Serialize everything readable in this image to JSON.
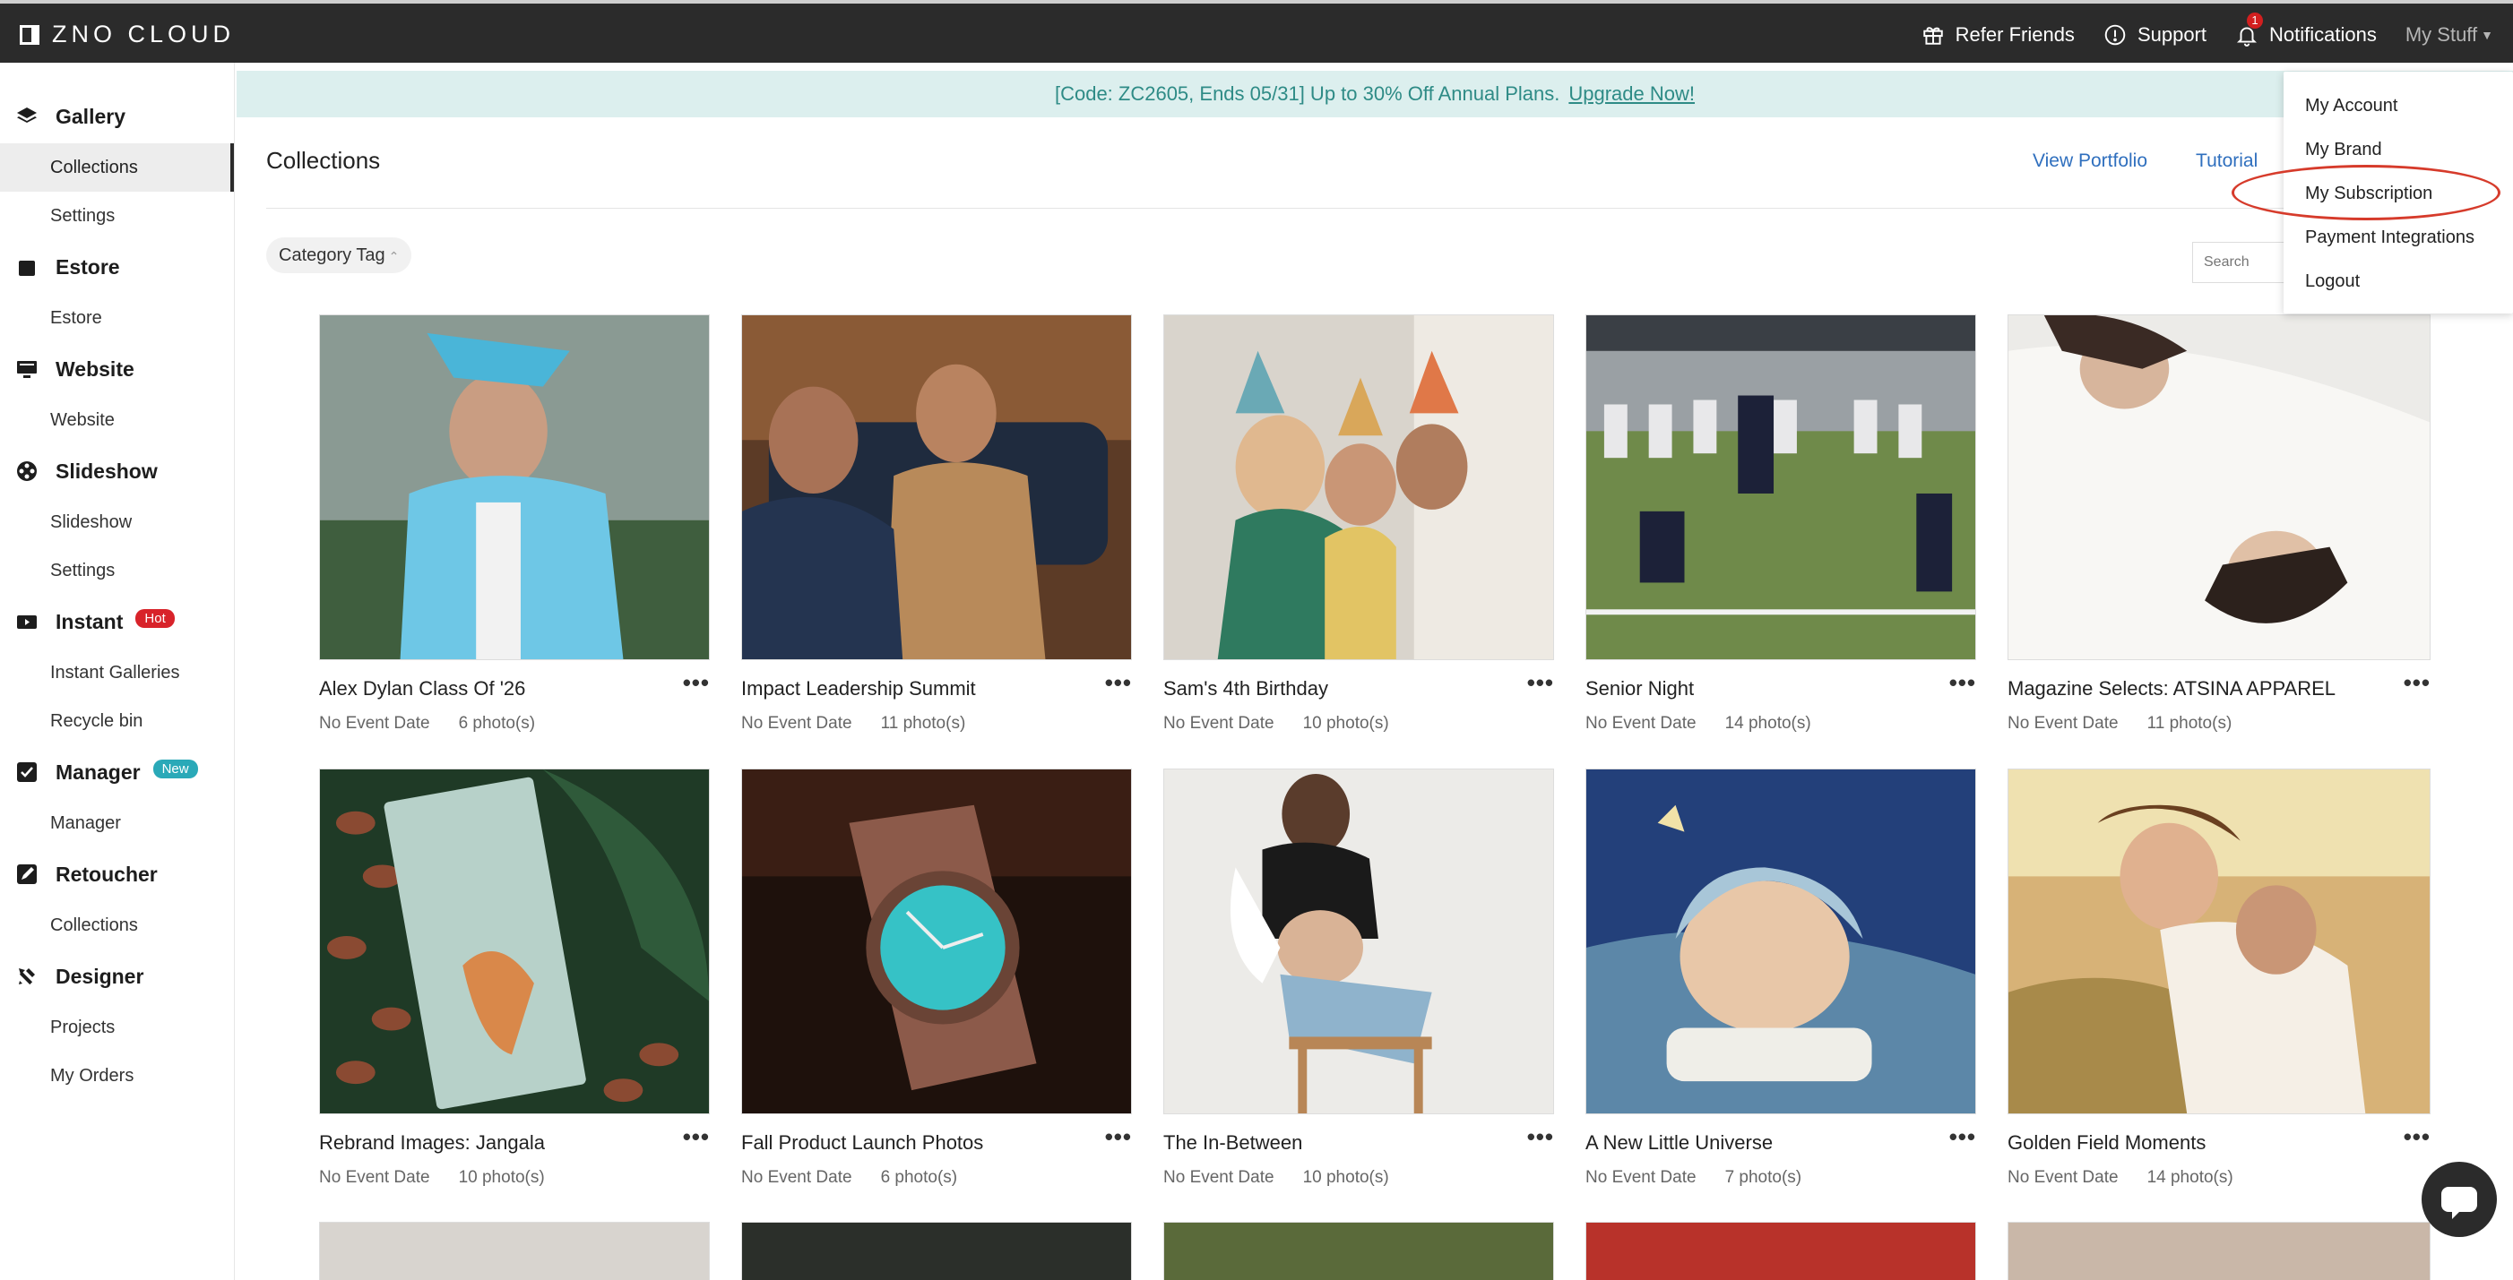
{
  "app": {
    "name": "ZNO CLOUD"
  },
  "topbar": {
    "refer": "Refer Friends",
    "support": "Support",
    "notifications": "Notifications",
    "notification_count": "1",
    "my_stuff": "My Stuff"
  },
  "sidebar": {
    "groups": [
      {
        "label": "Gallery",
        "items": [
          "Collections",
          "Settings"
        ],
        "active": "Collections"
      },
      {
        "label": "Estore",
        "items": [
          "Estore"
        ]
      },
      {
        "label": "Website",
        "items": [
          "Website"
        ]
      },
      {
        "label": "Slideshow",
        "items": [
          "Slideshow",
          "Settings"
        ]
      },
      {
        "label": "Instant",
        "badge": "Hot",
        "items": [
          "Instant Galleries",
          "Recycle bin"
        ]
      },
      {
        "label": "Manager",
        "badge": "New",
        "items": [
          "Manager"
        ]
      },
      {
        "label": "Retoucher",
        "items": [
          "Collections"
        ]
      },
      {
        "label": "Designer",
        "items": [
          "Projects",
          "My Orders"
        ]
      }
    ]
  },
  "banner": {
    "text": "[Code: ZC2605, Ends 05/31] Up to 30% Off Annual Plans.",
    "link": "Upgrade Now!"
  },
  "main": {
    "title": "Collections",
    "view_portfolio": "View Portfolio",
    "tutorial": "Tutorial",
    "category_tag": "Category Tag",
    "search_placeholder": "Search"
  },
  "collections": [
    {
      "title": "Alex Dylan Class Of '26",
      "date": "No Event Date",
      "count": "6 photo(s)"
    },
    {
      "title": "Impact Leadership Summit",
      "date": "No Event Date",
      "count": "11 photo(s)"
    },
    {
      "title": "Sam's 4th Birthday",
      "date": "No Event Date",
      "count": "10 photo(s)"
    },
    {
      "title": "Senior Night",
      "date": "No Event Date",
      "count": "14 photo(s)"
    },
    {
      "title": "Magazine Selects: ATSINA APPAREL",
      "date": "No Event Date",
      "count": "11 photo(s)"
    },
    {
      "title": "Rebrand Images: Jangala",
      "date": "No Event Date",
      "count": "10 photo(s)"
    },
    {
      "title": "Fall Product Launch Photos",
      "date": "No Event Date",
      "count": "6 photo(s)"
    },
    {
      "title": "The In-Between",
      "date": "No Event Date",
      "count": "10 photo(s)"
    },
    {
      "title": "A New Little Universe",
      "date": "No Event Date",
      "count": "7 photo(s)"
    },
    {
      "title": "Golden Field Moments",
      "date": "No Event Date",
      "count": "14 photo(s)"
    }
  ],
  "dropdown": {
    "items": [
      "My Account",
      "My Brand",
      "My Subscription",
      "Payment Integrations",
      "Logout"
    ],
    "highlighted": "My Subscription"
  },
  "colors": {
    "topbar": "#2b2b2b",
    "banner_bg": "#dcefee",
    "banner_text": "#2e8b86",
    "link": "#2f6fbe",
    "hot": "#d8232a",
    "new": "#2aa9b8",
    "highlight_ring": "#d63b2b"
  }
}
